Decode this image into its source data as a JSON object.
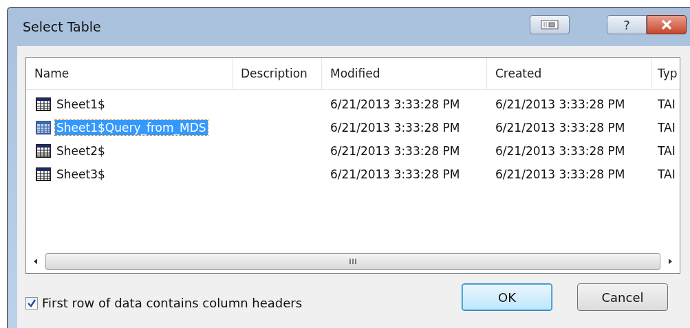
{
  "window": {
    "title": "Select Table"
  },
  "title_buttons": [
    {
      "kind": "restore"
    },
    {
      "kind": "help",
      "label": "?"
    },
    {
      "kind": "close"
    }
  ],
  "table": {
    "columns": [
      "Name",
      "Description",
      "Modified",
      "Created",
      "Typ"
    ],
    "rows": [
      {
        "name": "Sheet1$",
        "description": "",
        "modified": "6/21/2013 3:33:28 PM",
        "created": "6/21/2013 3:33:28 PM",
        "type": "TAI",
        "selected": false
      },
      {
        "name": "Sheet1$Query_from_MDS",
        "description": "",
        "modified": "6/21/2013 3:33:28 PM",
        "created": "6/21/2013 3:33:28 PM",
        "type": "TAI",
        "selected": true
      },
      {
        "name": "Sheet2$",
        "description": "",
        "modified": "6/21/2013 3:33:28 PM",
        "created": "6/21/2013 3:33:28 PM",
        "type": "TAI",
        "selected": false
      },
      {
        "name": "Sheet3$",
        "description": "",
        "modified": "6/21/2013 3:33:28 PM",
        "created": "6/21/2013 3:33:28 PM",
        "type": "TAI",
        "selected": false
      }
    ]
  },
  "checkbox": {
    "label": "First row of data contains column headers",
    "checked": true
  },
  "buttons": [
    {
      "label": "OK",
      "default": true
    },
    {
      "label": "Cancel",
      "default": false
    }
  ]
}
